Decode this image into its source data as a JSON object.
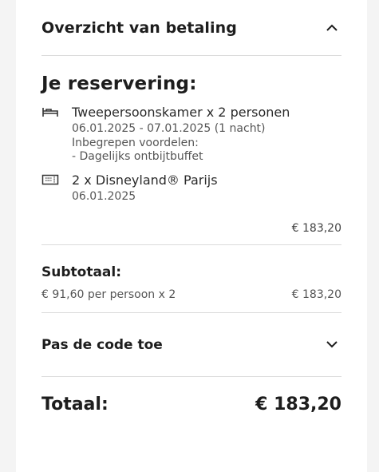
{
  "header": {
    "title": "Overzicht van betaling",
    "toggle_icon": "chevron-up-icon"
  },
  "reservation": {
    "title": "Je reservering:",
    "room": {
      "icon": "bed-icon",
      "name": "Tweepersoonskamer x 2 personen",
      "dates": "06.01.2025 - 07.01.2025 (1 nacht)",
      "benefits_label": "Inbegrepen voordelen:",
      "benefit": "- Dagelijks ontbijtbuffet"
    },
    "ticket": {
      "icon": "ticket-icon",
      "name": "2 x Disneyland® Parijs",
      "date": "06.01.2025"
    },
    "price": "€ 183,20"
  },
  "subtotal": {
    "title": "Subtotaal:",
    "detail": "€ 91,60 per persoon x 2",
    "amount": "€ 183,20"
  },
  "promo": {
    "title": "Pas de code toe",
    "toggle_icon": "chevron-down-icon"
  },
  "total": {
    "label": "Totaal:",
    "amount": "€ 183,20"
  }
}
